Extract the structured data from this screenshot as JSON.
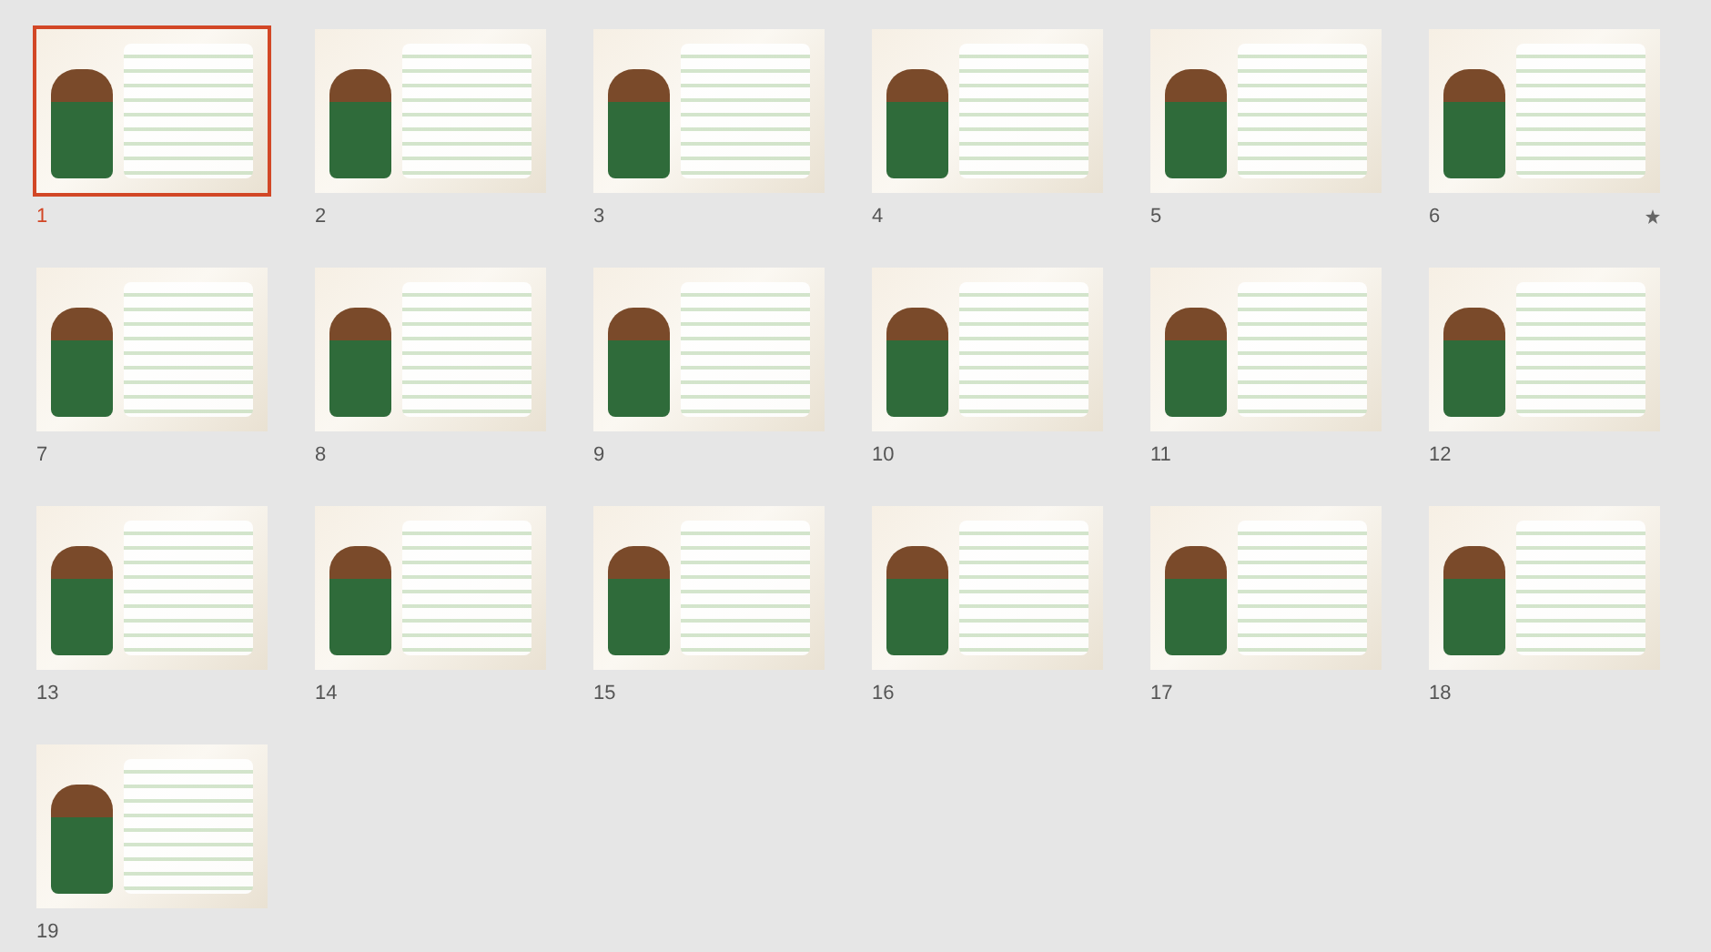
{
  "slides": [
    {
      "number": "1",
      "selected": true,
      "animated": false
    },
    {
      "number": "2",
      "selected": false,
      "animated": false
    },
    {
      "number": "3",
      "selected": false,
      "animated": false
    },
    {
      "number": "4",
      "selected": false,
      "animated": false
    },
    {
      "number": "5",
      "selected": false,
      "animated": false
    },
    {
      "number": "6",
      "selected": false,
      "animated": true
    },
    {
      "number": "7",
      "selected": false,
      "animated": false
    },
    {
      "number": "8",
      "selected": false,
      "animated": false
    },
    {
      "number": "9",
      "selected": false,
      "animated": false
    },
    {
      "number": "10",
      "selected": false,
      "animated": false
    },
    {
      "number": "11",
      "selected": false,
      "animated": false
    },
    {
      "number": "12",
      "selected": false,
      "animated": false
    },
    {
      "number": "13",
      "selected": false,
      "animated": false
    },
    {
      "number": "14",
      "selected": false,
      "animated": false
    },
    {
      "number": "15",
      "selected": false,
      "animated": false
    },
    {
      "number": "16",
      "selected": false,
      "animated": false
    },
    {
      "number": "17",
      "selected": false,
      "animated": false
    },
    {
      "number": "18",
      "selected": false,
      "animated": false
    },
    {
      "number": "19",
      "selected": false,
      "animated": false
    }
  ]
}
